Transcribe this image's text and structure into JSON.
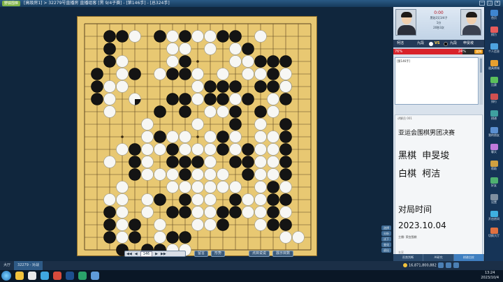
{
  "window": {
    "logo": "野狐围棋",
    "path": "[高级房1] > 32279号直播房 直播组客 [黑 9/4子赛] - [第146手] - [总324手]",
    "controls": [
      "—",
      "□",
      "✕"
    ]
  },
  "toolbar": {
    "nav": [
      "◀◀",
      "◀",
      "146",
      "▶",
      "▶▶"
    ],
    "buttons": [
      "留言",
      "形势",
      "点目说说",
      "展示目数"
    ]
  },
  "side_tools": [
    "选择",
    "分析",
    "试下",
    "变化",
    "退出"
  ],
  "players": {
    "white_rank": "9段",
    "black_rank": "9段",
    "info_lines": [
      "黑贴3又3/4子",
      "1分",
      "20秒3次"
    ],
    "timer": "0:00",
    "white_name": "柯洁",
    "black_name": "申旻埈",
    "white_label": "九段",
    "black_label": "九段",
    "vs": "VS"
  },
  "win_rate": {
    "white_percent": "76%",
    "black_percent": "24%",
    "white_fraction": 0.76,
    "support_label": "支持"
  },
  "comment_header": "[第146手]",
  "broadcast": {
    "header": "讲解员 001",
    "title": "亚运会围棋男团决赛",
    "black_label": "黑棋",
    "black_name": "申旻埈",
    "white_label": "白棋",
    "white_name": "柯洁",
    "time_label": "对局时间",
    "date": "2023.10.04",
    "host": "主播: 荣宜围棋",
    "footer": "名家"
  },
  "panel_tabs": [
    {
      "label": "形势判断",
      "active": false
    },
    {
      "label": "AI研究",
      "active": false
    },
    {
      "label": "棋谱比较",
      "active": true
    }
  ],
  "right_buttons": [
    {
      "label": "首页",
      "color": "#3f86d0"
    },
    {
      "label": "棋力",
      "color": "#e65b5b"
    },
    {
      "label": "个人信息",
      "color": "#4ea3e0"
    },
    {
      "label": "道具商城",
      "color": "#e7a030"
    },
    {
      "label": "比赛",
      "color": "#5bbf5b"
    },
    {
      "label": "排行",
      "color": "#d05050"
    },
    {
      "label": "棋谱",
      "color": "#3fa0a0"
    },
    {
      "label": "我的朋友",
      "color": "#5b8fd0"
    },
    {
      "label": "聊天",
      "color": "#c07adb"
    },
    {
      "label": "帮助",
      "color": "#d0a040"
    },
    {
      "label": "好友",
      "color": "#4eb070"
    },
    {
      "label": "设置",
      "color": "#7f8fa0"
    },
    {
      "label": "开启房间",
      "color": "#3fb0e0"
    },
    {
      "label": "切换大厅",
      "color": "#e07040"
    }
  ],
  "bottom": {
    "tabs": [
      {
        "label": "大厅",
        "active": false
      },
      {
        "label": "32279 - 对战",
        "active": true
      }
    ],
    "coins": "16,871,800,882",
    "taskbar_time": "13:24",
    "taskbar_date": "2023/10/4"
  },
  "board_data": {
    "size": 19,
    "last_move": [
      4,
      6
    ],
    "black": [
      [
        2,
        1
      ],
      [
        3,
        1
      ],
      [
        6,
        1
      ],
      [
        8,
        1
      ],
      [
        11,
        1
      ],
      [
        12,
        1
      ],
      [
        2,
        2
      ],
      [
        13,
        2
      ],
      [
        2,
        3
      ],
      [
        8,
        3
      ],
      [
        14,
        3
      ],
      [
        15,
        3
      ],
      [
        16,
        3
      ],
      [
        1,
        4
      ],
      [
        4,
        4
      ],
      [
        7,
        4
      ],
      [
        8,
        4
      ],
      [
        15,
        4
      ],
      [
        1,
        5
      ],
      [
        10,
        5
      ],
      [
        11,
        5
      ],
      [
        12,
        5
      ],
      [
        14,
        5
      ],
      [
        15,
        5
      ],
      [
        16,
        5
      ],
      [
        1,
        6
      ],
      [
        7,
        6
      ],
      [
        8,
        6
      ],
      [
        10,
        6
      ],
      [
        11,
        6
      ],
      [
        13,
        6
      ],
      [
        16,
        6
      ],
      [
        6,
        7
      ],
      [
        8,
        7
      ],
      [
        12,
        7
      ],
      [
        14,
        7
      ],
      [
        12,
        8
      ],
      [
        16,
        8
      ],
      [
        6,
        9
      ],
      [
        11,
        9
      ],
      [
        16,
        9
      ],
      [
        4,
        10
      ],
      [
        7,
        10
      ],
      [
        11,
        10
      ],
      [
        13,
        10
      ],
      [
        16,
        10
      ],
      [
        4,
        11
      ],
      [
        7,
        11
      ],
      [
        8,
        11
      ],
      [
        9,
        11
      ],
      [
        12,
        11
      ],
      [
        13,
        11
      ],
      [
        16,
        11
      ],
      [
        4,
        12
      ],
      [
        8,
        12
      ],
      [
        13,
        12
      ],
      [
        16,
        12
      ],
      [
        15,
        13
      ],
      [
        6,
        14
      ],
      [
        8,
        14
      ],
      [
        12,
        14
      ],
      [
        15,
        14
      ],
      [
        16,
        14
      ],
      [
        2,
        15
      ],
      [
        7,
        15
      ],
      [
        8,
        15
      ],
      [
        11,
        15
      ],
      [
        12,
        15
      ],
      [
        15,
        15
      ],
      [
        2,
        16
      ],
      [
        4,
        16
      ],
      [
        11,
        16
      ],
      [
        15,
        16
      ],
      [
        16,
        16
      ],
      [
        2,
        17
      ],
      [
        4,
        17
      ],
      [
        7,
        17
      ],
      [
        8,
        17
      ],
      [
        3,
        18
      ],
      [
        5,
        18
      ],
      [
        6,
        18
      ]
    ],
    "white": [
      [
        4,
        1
      ],
      [
        7,
        1
      ],
      [
        9,
        1
      ],
      [
        10,
        1
      ],
      [
        14,
        1
      ],
      [
        7,
        2
      ],
      [
        8,
        2
      ],
      [
        10,
        2
      ],
      [
        12,
        2
      ],
      [
        3,
        3
      ],
      [
        7,
        3
      ],
      [
        12,
        3
      ],
      [
        13,
        3
      ],
      [
        3,
        4
      ],
      [
        6,
        4
      ],
      [
        9,
        4
      ],
      [
        11,
        4
      ],
      [
        13,
        4
      ],
      [
        14,
        4
      ],
      [
        16,
        4
      ],
      [
        2,
        5
      ],
      [
        3,
        5
      ],
      [
        9,
        5
      ],
      [
        16,
        5
      ],
      [
        2,
        6
      ],
      [
        9,
        6
      ],
      [
        12,
        6
      ],
      [
        15,
        6
      ],
      [
        2,
        7
      ],
      [
        10,
        7
      ],
      [
        11,
        7
      ],
      [
        15,
        7
      ],
      [
        5,
        8
      ],
      [
        9,
        8
      ],
      [
        14,
        8
      ],
      [
        5,
        9
      ],
      [
        7,
        9
      ],
      [
        8,
        9
      ],
      [
        10,
        9
      ],
      [
        12,
        9
      ],
      [
        14,
        9
      ],
      [
        15,
        9
      ],
      [
        3,
        10
      ],
      [
        5,
        10
      ],
      [
        6,
        10
      ],
      [
        8,
        10
      ],
      [
        9,
        10
      ],
      [
        10,
        10
      ],
      [
        12,
        10
      ],
      [
        14,
        10
      ],
      [
        15,
        10
      ],
      [
        2,
        11
      ],
      [
        5,
        11
      ],
      [
        10,
        11
      ],
      [
        14,
        11
      ],
      [
        15,
        11
      ],
      [
        5,
        12
      ],
      [
        6,
        12
      ],
      [
        7,
        12
      ],
      [
        9,
        12
      ],
      [
        10,
        12
      ],
      [
        11,
        12
      ],
      [
        14,
        12
      ],
      [
        15,
        12
      ],
      [
        3,
        13
      ],
      [
        7,
        13
      ],
      [
        8,
        13
      ],
      [
        9,
        13
      ],
      [
        10,
        13
      ],
      [
        11,
        13
      ],
      [
        12,
        13
      ],
      [
        14,
        13
      ],
      [
        16,
        13
      ],
      [
        2,
        14
      ],
      [
        3,
        14
      ],
      [
        5,
        14
      ],
      [
        9,
        14
      ],
      [
        10,
        14
      ],
      [
        13,
        14
      ],
      [
        14,
        14
      ],
      [
        3,
        15
      ],
      [
        5,
        15
      ],
      [
        9,
        15
      ],
      [
        10,
        15
      ],
      [
        13,
        15
      ],
      [
        14,
        15
      ],
      [
        16,
        15
      ],
      [
        3,
        16
      ],
      [
        6,
        16
      ],
      [
        9,
        16
      ],
      [
        10,
        16
      ],
      [
        14,
        16
      ],
      [
        3,
        17
      ],
      [
        6,
        17
      ],
      [
        16,
        17
      ],
      [
        17,
        17
      ],
      [
        7,
        18
      ],
      [
        8,
        18
      ]
    ]
  }
}
